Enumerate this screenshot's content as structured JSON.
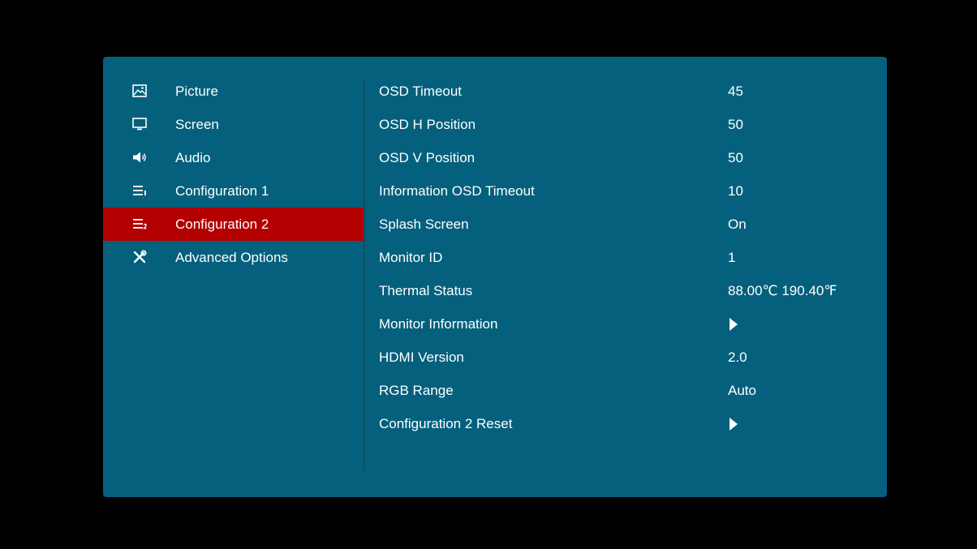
{
  "colors": {
    "panel_bg": "#04607d",
    "active_bg": "#b30000",
    "screen_bg": "#000000",
    "text": "#ffffff"
  },
  "sidebar": {
    "items": [
      {
        "label": "Picture",
        "icon": "picture-icon",
        "active": false
      },
      {
        "label": "Screen",
        "icon": "monitor-icon",
        "active": false
      },
      {
        "label": "Audio",
        "icon": "speaker-icon",
        "active": false
      },
      {
        "label": "Configuration 1",
        "icon": "config1-icon",
        "active": false
      },
      {
        "label": "Configuration 2",
        "icon": "config2-icon",
        "active": true
      },
      {
        "label": "Advanced Options",
        "icon": "tools-icon",
        "active": false
      }
    ]
  },
  "settings": {
    "rows": [
      {
        "label": "OSD Timeout",
        "value": "45"
      },
      {
        "label": "OSD H Position",
        "value": "50"
      },
      {
        "label": "OSD V Position",
        "value": "50"
      },
      {
        "label": "Information OSD Timeout",
        "value": "10"
      },
      {
        "label": "Splash Screen",
        "value": "On"
      },
      {
        "label": "Monitor ID",
        "value": "1"
      },
      {
        "label": "Thermal Status",
        "value": "88.00℃ 190.40℉"
      },
      {
        "label": "Monitor Information",
        "value": "",
        "submenu": true
      },
      {
        "label": "HDMI Version",
        "value": "2.0"
      },
      {
        "label": "RGB Range",
        "value": "Auto"
      },
      {
        "label": "Configuration 2 Reset",
        "value": "",
        "submenu": true
      }
    ]
  }
}
